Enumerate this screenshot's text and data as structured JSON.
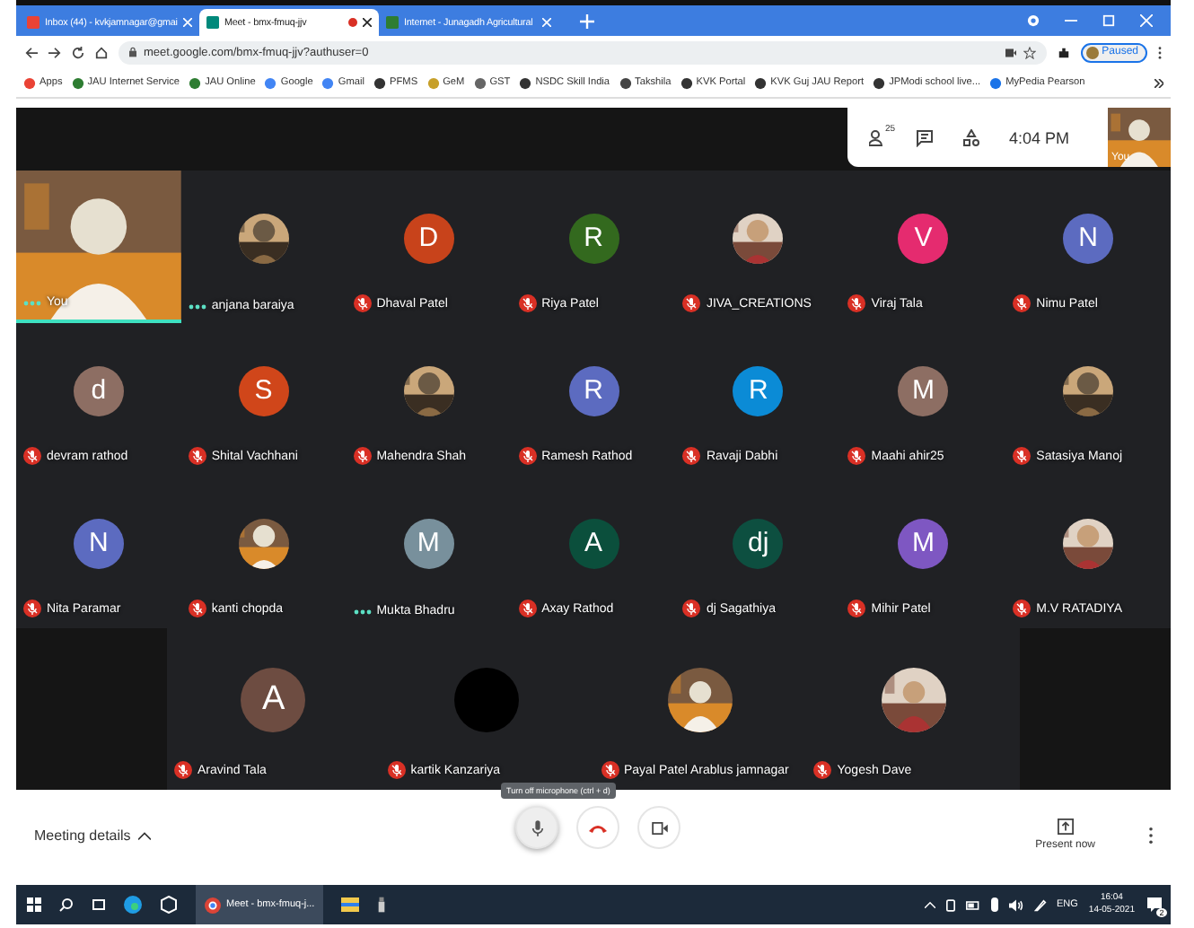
{
  "browser": {
    "tabs": [
      {
        "title": "Inbox (44) - kvkjamnagar@gmai",
        "selected": false,
        "recording": false
      },
      {
        "title": "Meet - bmx-fmuq-jjv",
        "selected": true,
        "recording": true
      },
      {
        "title": "Internet - Junagadh Agricultural",
        "selected": false,
        "recording": false
      }
    ],
    "address": "meet.google.com/bmx-fmuq-jjv?authuser=0",
    "profile": "Paused",
    "bookmarks": [
      "Apps",
      "JAU Internet Service",
      "JAU Online",
      "Google",
      "Gmail",
      "PFMS",
      "GeM",
      "GST",
      "NSDC Skill India",
      "Takshila",
      "KVK Portal",
      "KVK Guj JAU Report",
      "JPModi school live...",
      "MyPedia Pearson"
    ]
  },
  "meet_bar": {
    "participant_count": "25",
    "time": "4:04 PM",
    "self_view_label": "You"
  },
  "rows": [
    [
      {
        "name": "You",
        "avatar": {
          "kind": "video"
        },
        "muted": false,
        "speaking": true
      },
      {
        "name": "anjana baraiya",
        "muted": false,
        "speaking": false
      },
      {
        "name": "Dhaval Patel",
        "avatar": {
          "kind": "letter",
          "letter": "D",
          "color": "#c8431b"
        },
        "muted": true,
        "speaking": false
      },
      {
        "name": "Riya Patel",
        "avatar": {
          "kind": "letter",
          "letter": "R",
          "color": "#33691e"
        },
        "muted": true,
        "speaking": false
      },
      {
        "name": "JIVA_CREATIONS",
        "muted": true,
        "speaking": false
      },
      {
        "name": "Viraj Tala",
        "avatar": {
          "kind": "letter",
          "letter": "V",
          "color": "#e52b6f"
        },
        "muted": true,
        "speaking": false
      },
      {
        "name": "Nimu Patel",
        "avatar": {
          "kind": "letter",
          "letter": "N",
          "color": "#5c6bc0"
        },
        "muted": true,
        "speaking": false
      }
    ],
    [
      {
        "name": "devram rathod",
        "avatar": {
          "kind": "letter",
          "letter": "d",
          "color": "#8d6e63"
        },
        "muted": true,
        "speaking": false
      },
      {
        "name": "Shital Vachhani",
        "avatar": {
          "kind": "letter",
          "letter": "S",
          "color": "#d0461a"
        },
        "muted": true,
        "speaking": false
      },
      {
        "name": "Mahendra Shah",
        "muted": true,
        "speaking": false
      },
      {
        "name": "Ramesh Rathod",
        "avatar": {
          "kind": "letter",
          "letter": "R",
          "color": "#5c6bc0"
        },
        "muted": true,
        "speaking": false
      },
      {
        "name": "Ravaji Dabhi",
        "avatar": {
          "kind": "letter",
          "letter": "R",
          "color": "#0b8bd6"
        },
        "muted": true,
        "speaking": false
      },
      {
        "name": "Maahi ahir25",
        "avatar": {
          "kind": "letter",
          "letter": "M",
          "color": "#8d6e63"
        },
        "muted": true,
        "speaking": false
      },
      {
        "name": "Satasiya Manoj",
        "muted": true,
        "speaking": false
      }
    ],
    [
      {
        "name": "Nita Paramar",
        "avatar": {
          "kind": "letter",
          "letter": "N",
          "color": "#5c6bc0"
        },
        "muted": true,
        "speaking": false
      },
      {
        "name": "kanti chopda",
        "muted": true,
        "speaking": false
      },
      {
        "name": "Mukta Bhadru",
        "avatar": {
          "kind": "letter",
          "letter": "M",
          "color": "#78909c"
        },
        "muted": false,
        "speaking": false
      },
      {
        "name": "Axay Rathod",
        "avatar": {
          "kind": "letter",
          "letter": "A",
          "color": "#0b4f3c"
        },
        "muted": true,
        "speaking": false
      },
      {
        "name": "dj Sagathiya",
        "avatar": {
          "kind": "letter",
          "letter": "dj",
          "color": "#0d4f40"
        },
        "muted": true,
        "speaking": false
      },
      {
        "name": "Mihir Patel",
        "avatar": {
          "kind": "letter",
          "letter": "M",
          "color": "#7e57c2"
        },
        "muted": true,
        "speaking": false
      },
      {
        "name": "M.V RATADIYA",
        "muted": true,
        "speaking": false
      }
    ],
    [
      {
        "name": "Aravind Tala",
        "avatar": {
          "kind": "letter",
          "letter": "A",
          "color": "#6d4c41"
        },
        "muted": true,
        "speaking": false
      },
      {
        "name": "kartik Kanzariya",
        "avatar": {
          "kind": "blank",
          "color": "#000000"
        },
        "muted": true,
        "speaking": false
      },
      {
        "name": "Payal Patel Arablus jamnagar",
        "muted": true,
        "speaking": false
      },
      {
        "name": "Yogesh Dave",
        "muted": true,
        "speaking": false
      }
    ]
  ],
  "controls": {
    "meeting_details": "Meeting details",
    "tooltip": "Turn off microphone (ctrl + d)",
    "present": "Present now"
  },
  "taskbar": {
    "app": "Meet - bmx-fmuq-j...",
    "language": "ENG",
    "time": "16:04",
    "date": "14-05-2021",
    "notifications": "2"
  }
}
